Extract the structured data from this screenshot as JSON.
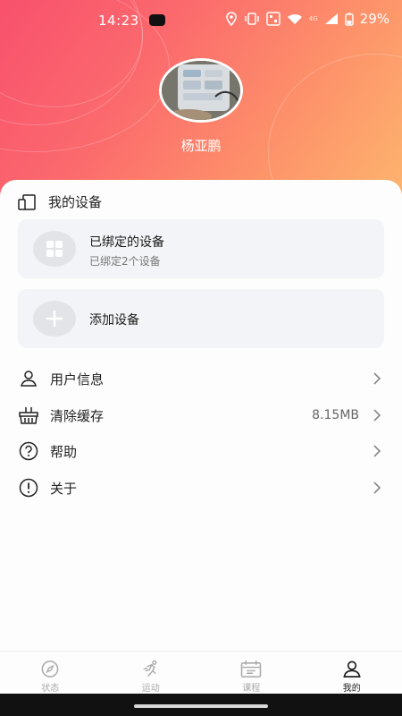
{
  "status_bar": {
    "time": "14:23",
    "network": "4G",
    "battery": "29%"
  },
  "profile": {
    "username": "杨亚鹏"
  },
  "devices_section": {
    "title": "我的设备",
    "bound": {
      "title": "已绑定的设备",
      "subtitle": "已绑定2个设备"
    },
    "add": {
      "title": "添加设备"
    }
  },
  "menu": [
    {
      "label": "用户信息",
      "value": "",
      "icon": "user-icon"
    },
    {
      "label": "清除缓存",
      "value": "8.15MB",
      "icon": "broom-icon"
    },
    {
      "label": "帮助",
      "value": "",
      "icon": "help-icon"
    },
    {
      "label": "关于",
      "value": "",
      "icon": "info-icon"
    }
  ],
  "tabs": [
    {
      "label": "状态",
      "icon": "compass-icon",
      "active": false
    },
    {
      "label": "运动",
      "icon": "running-icon",
      "active": false
    },
    {
      "label": "课程",
      "icon": "calendar-icon",
      "active": false
    },
    {
      "label": "我的",
      "icon": "profile-icon",
      "active": true
    }
  ],
  "colors": {
    "gradient_start": "#f8516d",
    "gradient_end": "#fdb56e",
    "active_tab": "#222222",
    "inactive_tab": "#aaaaaa"
  }
}
